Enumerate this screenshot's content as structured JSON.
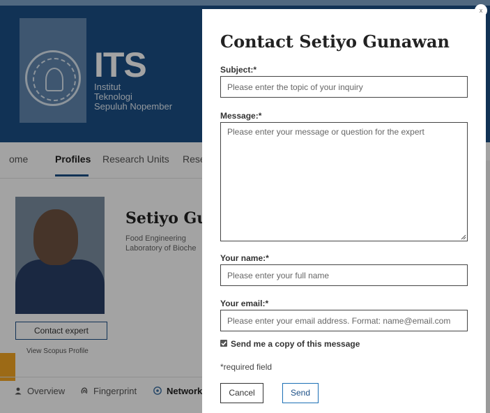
{
  "background_page": {
    "logo": {
      "name": "ITS",
      "line1": "Institut",
      "line2": "Teknologi",
      "line3": "Sepuluh Nopember"
    },
    "nav": {
      "home": "ome",
      "profiles": "Profiles",
      "research_units": "Research Units",
      "research_cut": "Rese"
    },
    "profile": {
      "name_partial": "Setiyo Gu",
      "department": "Food Engineering",
      "lab_partial": "Laboratory of Bioche",
      "contact_button": "Contact expert",
      "scopus_link": "View Scopus Profile"
    },
    "tabs": {
      "overview": "Overview",
      "fingerprint": "Fingerprint",
      "network": "Network"
    }
  },
  "modal": {
    "title": "Contact Setiyo Gunawan",
    "close_symbol": "x",
    "subject": {
      "label": "Subject:*",
      "placeholder": "Please enter the topic of your inquiry"
    },
    "message": {
      "label": "Message:*",
      "placeholder": "Please enter your message or question for the expert"
    },
    "your_name": {
      "label": "Your name:*",
      "placeholder": "Please enter your full name"
    },
    "your_email": {
      "label": "Your email:*",
      "placeholder": "Please enter your email address. Format: name@email.com"
    },
    "copy_checkbox": {
      "label": "Send me a copy of this message",
      "checked": true
    },
    "required_note": "*required field",
    "cancel_button": "Cancel",
    "send_button": "Send"
  },
  "colors": {
    "brand_blue": "#1b4f86",
    "accent_orange": "#f5a623"
  }
}
